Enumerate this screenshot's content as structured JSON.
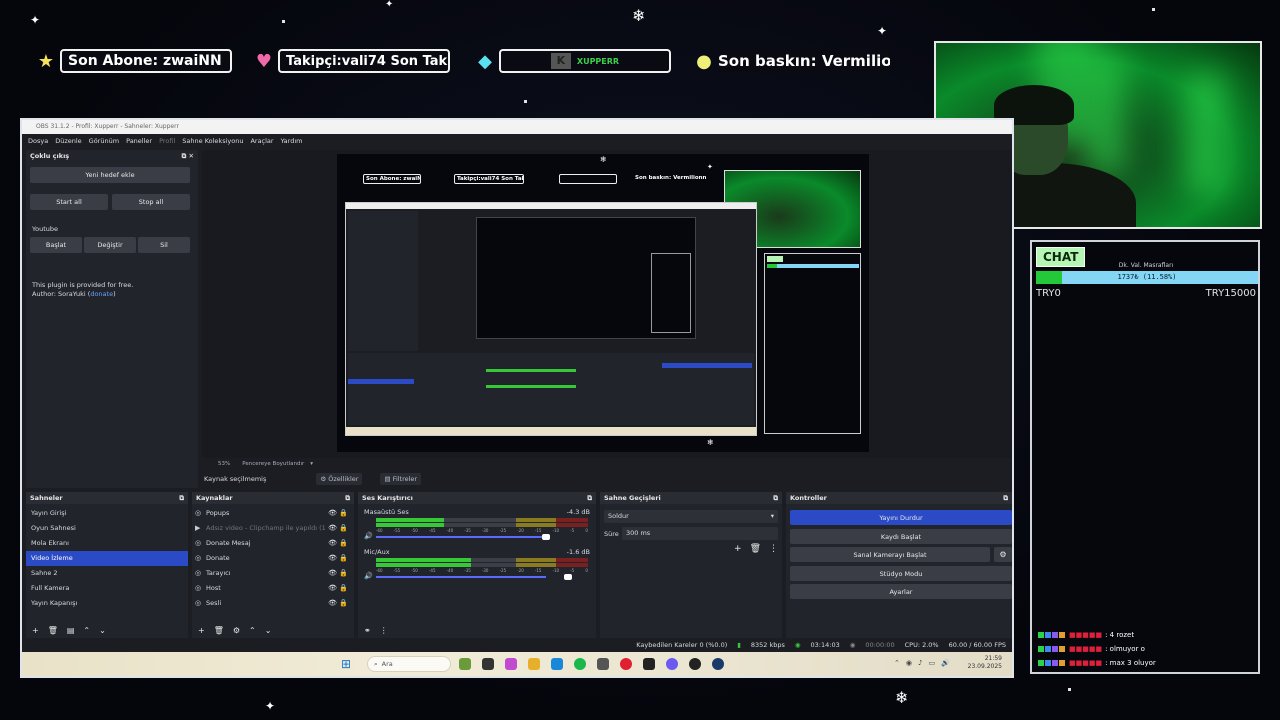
{
  "overlay": {
    "last_sub": "Son Abone: zwaiNN",
    "followers": "Takipçi:vali74   Son Tak",
    "brand": "XUPPERR",
    "last_raid": "Son baskın: Vermilionn"
  },
  "chat": {
    "title": "CHAT",
    "goal_label": "Dk. Val. Masrafları",
    "goal_text": "1737₺ (11.58%)",
    "goal_fraction": 0.1158,
    "goal_min": "TRY0",
    "goal_max": "TRY15000",
    "messages": [
      {
        "text": ": 4 rozet"
      },
      {
        "text": ": olmuyor o"
      },
      {
        "text": ": max 3 oluyor"
      }
    ]
  },
  "obs": {
    "title": "OBS 31.1.2 - Profil: Xupperr - Sahneler: Xupperr",
    "menu": [
      "Dosya",
      "Düzenle",
      "Görünüm",
      "Paneller",
      "Profil",
      "Sahne Koleksiyonu",
      "Araçlar",
      "Yardım"
    ],
    "multistream": {
      "title": "Çoklu çıkış",
      "add_target": "Yeni hedef ekle",
      "start_all": "Start all",
      "stop_all": "Stop all",
      "target_name": "Youtube",
      "start": "Başlat",
      "change": "Değiştir",
      "delete": "Sil",
      "info_line1": "This plugin is provided for free.",
      "info_line2_prefix": "Author: SoraYuki (",
      "info_link": "donate",
      "info_line2_suffix": ")"
    },
    "zoom": "53%",
    "fit_mode": "Pencereye Boyutlandır",
    "no_source": "Kaynak seçilmemiş",
    "properties": "Özellikler",
    "filters": "Filtreler",
    "scenes": {
      "title": "Sahneler",
      "items": [
        "Yayın Girişi",
        "Oyun Sahnesi",
        "Mola Ekranı",
        "Video İzleme",
        "Sahne 2",
        "Full Kamera",
        "Yayın Kapanışı"
      ],
      "selected_index": 3
    },
    "sources": {
      "title": "Kaynaklar",
      "items": [
        "Popups",
        "Adsız video - Clipchamp ile yapıldı (1",
        "Donate Mesaj",
        "Donate",
        "Tarayıcı",
        "Host",
        "Sesli"
      ]
    },
    "mixer": {
      "title": "Ses Karıştırıcı",
      "channels": [
        {
          "name": "Masaüstü Ses",
          "db": "-4.3 dB",
          "level": 0.32
        },
        {
          "name": "Mic/Aux",
          "db": "-1.6 dB",
          "level": 0.45
        }
      ],
      "ticks": [
        "-60",
        "-55",
        "-50",
        "-45",
        "-40",
        "-35",
        "-30",
        "-25",
        "-20",
        "-15",
        "-10",
        "-5",
        "0"
      ]
    },
    "transitions": {
      "title": "Sahne Geçişleri",
      "selected": "Soldur",
      "duration_label": "Süre",
      "duration": "300 ms"
    },
    "controls": {
      "title": "Kontroller",
      "stop_stream": "Yayını Durdur",
      "start_record": "Kaydı Başlat",
      "virtual_cam": "Sanal Kamerayı Başlat",
      "studio_mode": "Stüdyo Modu",
      "settings": "Ayarlar"
    },
    "status": {
      "dropped": "Kaybedilen Kareler 0 (%0.0)",
      "bitrate": "8352 kbps",
      "stream_time": "03:14:03",
      "rec_time": "00:00:00",
      "cpu": "CPU: 2.0%",
      "fps": "60.00 / 60.00 FPS"
    }
  },
  "taskbar": {
    "search_placeholder": "Ara",
    "time": "21:59",
    "date": "23.09.2025"
  },
  "colors": {
    "accent": "#2b4ac6",
    "meter_green": "#36c836",
    "goal_fill": "#24c93a",
    "goal_bg": "#84d6f5"
  }
}
